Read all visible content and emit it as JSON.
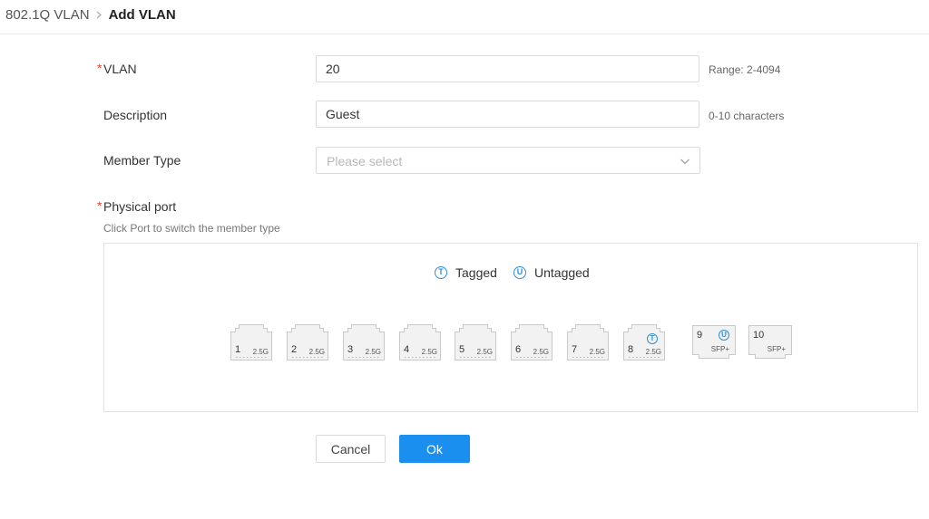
{
  "breadcrumb": {
    "parent": "802.1Q VLAN",
    "current": "Add VLAN"
  },
  "form": {
    "vlan": {
      "label": "VLAN",
      "value": "20",
      "hint": "Range: 2-4094"
    },
    "description": {
      "label": "Description",
      "value": "Guest",
      "hint": "0-10 characters"
    },
    "member_type": {
      "label": "Member Type",
      "placeholder": "Please select"
    },
    "physical_port": {
      "label": "Physical port",
      "hint": "Click Port to switch the member type"
    }
  },
  "required_mark": "*",
  "legend": {
    "tagged": {
      "badge": "T",
      "label": "Tagged"
    },
    "untagged": {
      "badge": "U",
      "label": "Untagged"
    }
  },
  "ports": [
    {
      "num": "1",
      "speed": "2.5G",
      "member": ""
    },
    {
      "num": "2",
      "speed": "2.5G",
      "member": ""
    },
    {
      "num": "3",
      "speed": "2.5G",
      "member": ""
    },
    {
      "num": "4",
      "speed": "2.5G",
      "member": ""
    },
    {
      "num": "5",
      "speed": "2.5G",
      "member": ""
    },
    {
      "num": "6",
      "speed": "2.5G",
      "member": ""
    },
    {
      "num": "7",
      "speed": "2.5G",
      "member": ""
    },
    {
      "num": "8",
      "speed": "2.5G",
      "member": "T"
    },
    {
      "num": "9",
      "speed": "SFP+",
      "member": "U"
    },
    {
      "num": "10",
      "speed": "SFP+",
      "member": ""
    }
  ],
  "buttons": {
    "cancel": "Cancel",
    "ok": "Ok"
  },
  "colors": {
    "accent": "#1a8ff0",
    "required": "#e8412f",
    "badge": "#2e8fd6"
  }
}
